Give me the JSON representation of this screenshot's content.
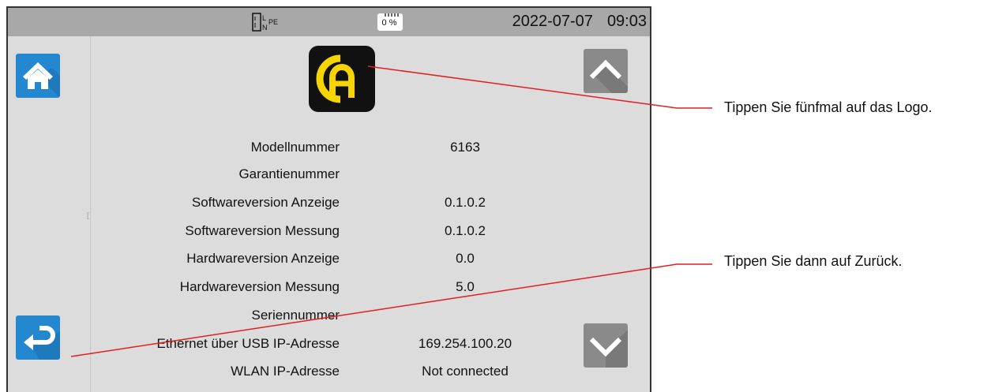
{
  "statusbar": {
    "date": "2022-07-07",
    "time": "09:03",
    "plug_label_l": "L",
    "plug_label_n": "N",
    "plug_label_pe": "PE",
    "sd_percent": "0 %"
  },
  "icons": {
    "home": "home-icon",
    "back": "return-arrow-icon",
    "up": "chevron-up-icon",
    "down": "chevron-down-icon",
    "plug": "wiring-icon",
    "sd": "sd-card-icon",
    "logo": "ca-logo"
  },
  "colors": {
    "nav_button": "#2488d0",
    "scroll_button": "#8a8a8a",
    "statusbar": "#a8a8a8",
    "screen_bg": "#dcdcdc",
    "logo_yellow": "#f5d400",
    "callout_line": "#e02020"
  },
  "info": [
    {
      "label": "Modellnummer",
      "value": "6163"
    },
    {
      "label": "Garantienummer",
      "value": ""
    },
    {
      "label": "Softwareversion Anzeige",
      "value": "0.1.0.2"
    },
    {
      "label": "Softwareversion Messung",
      "value": "0.1.0.2"
    },
    {
      "label": "Hardwareversion Anzeige",
      "value": "0.0"
    },
    {
      "label": "Hardwareversion Messung",
      "value": "5.0"
    },
    {
      "label": "Seriennummer",
      "value": ""
    },
    {
      "label": "Ethernet über USB IP-Adresse",
      "value": "169.254.100.20"
    },
    {
      "label": "WLAN IP-Adresse",
      "value": "Not connected"
    }
  ],
  "callouts": {
    "logo_hint": "Tippen Sie fünfmal auf das Logo.",
    "back_hint": "Tippen Sie dann auf Zurück."
  }
}
